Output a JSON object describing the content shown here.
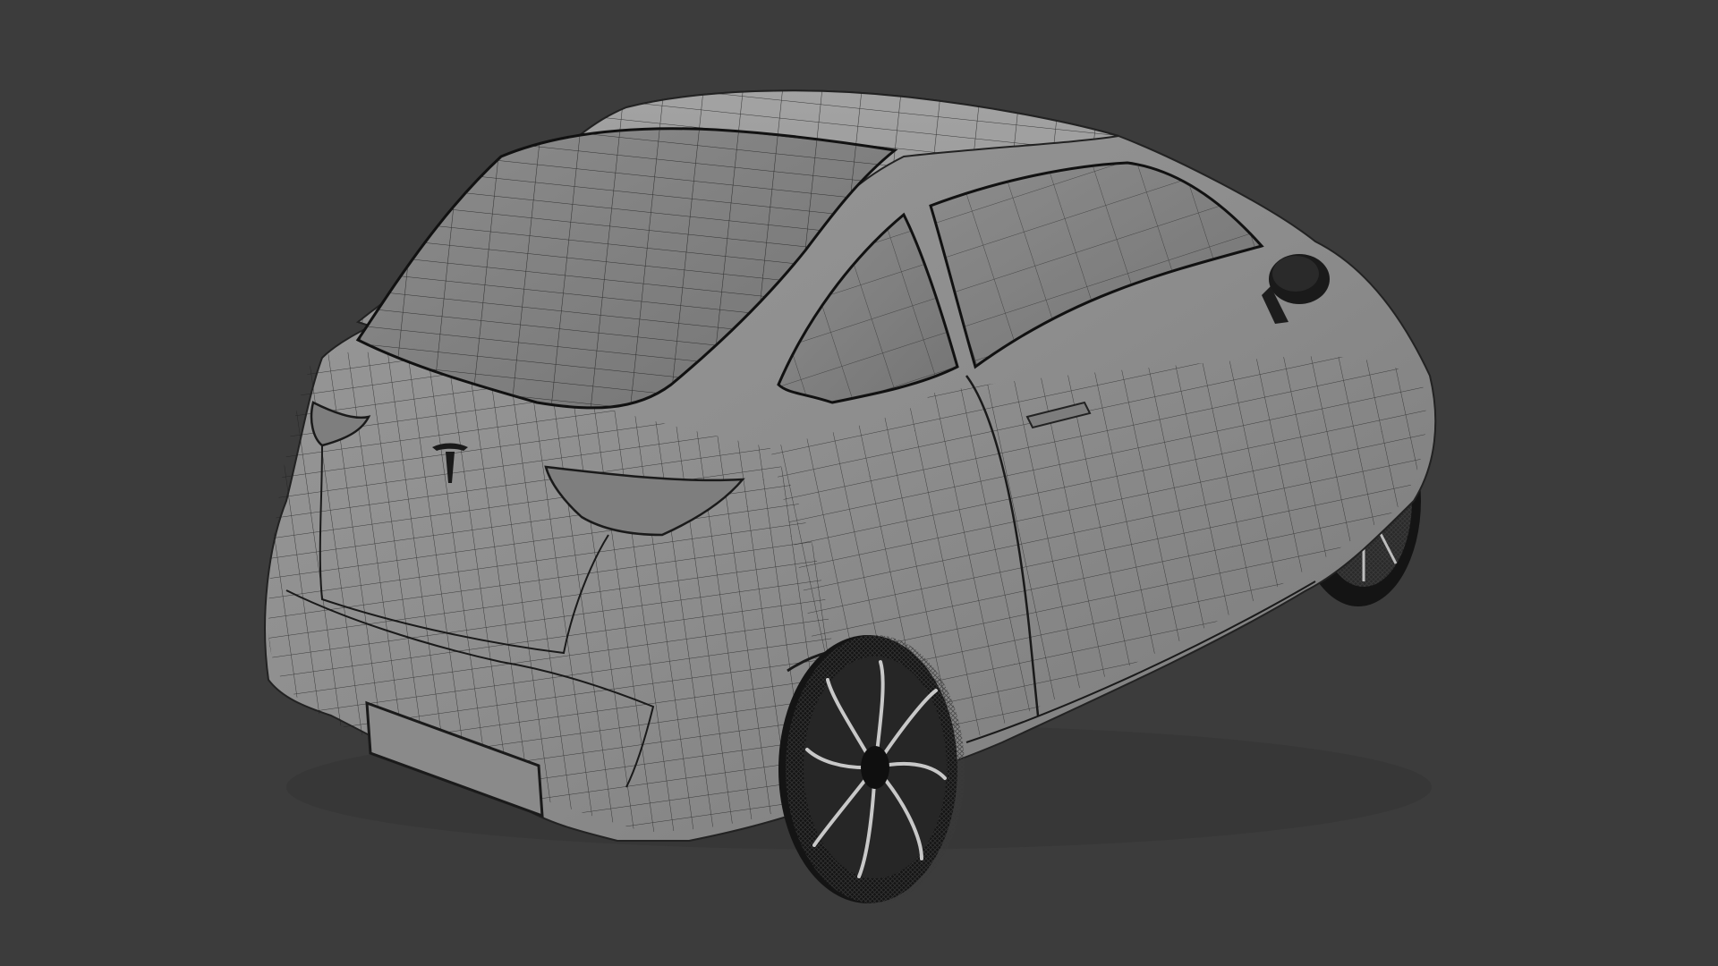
{
  "viewport": {
    "background_color": "#3c3c3c",
    "subject": "car-wireframe-render",
    "body_color": "#8e8e8e",
    "wire_color": "#1e1e1e",
    "tire_color": "#141414"
  }
}
